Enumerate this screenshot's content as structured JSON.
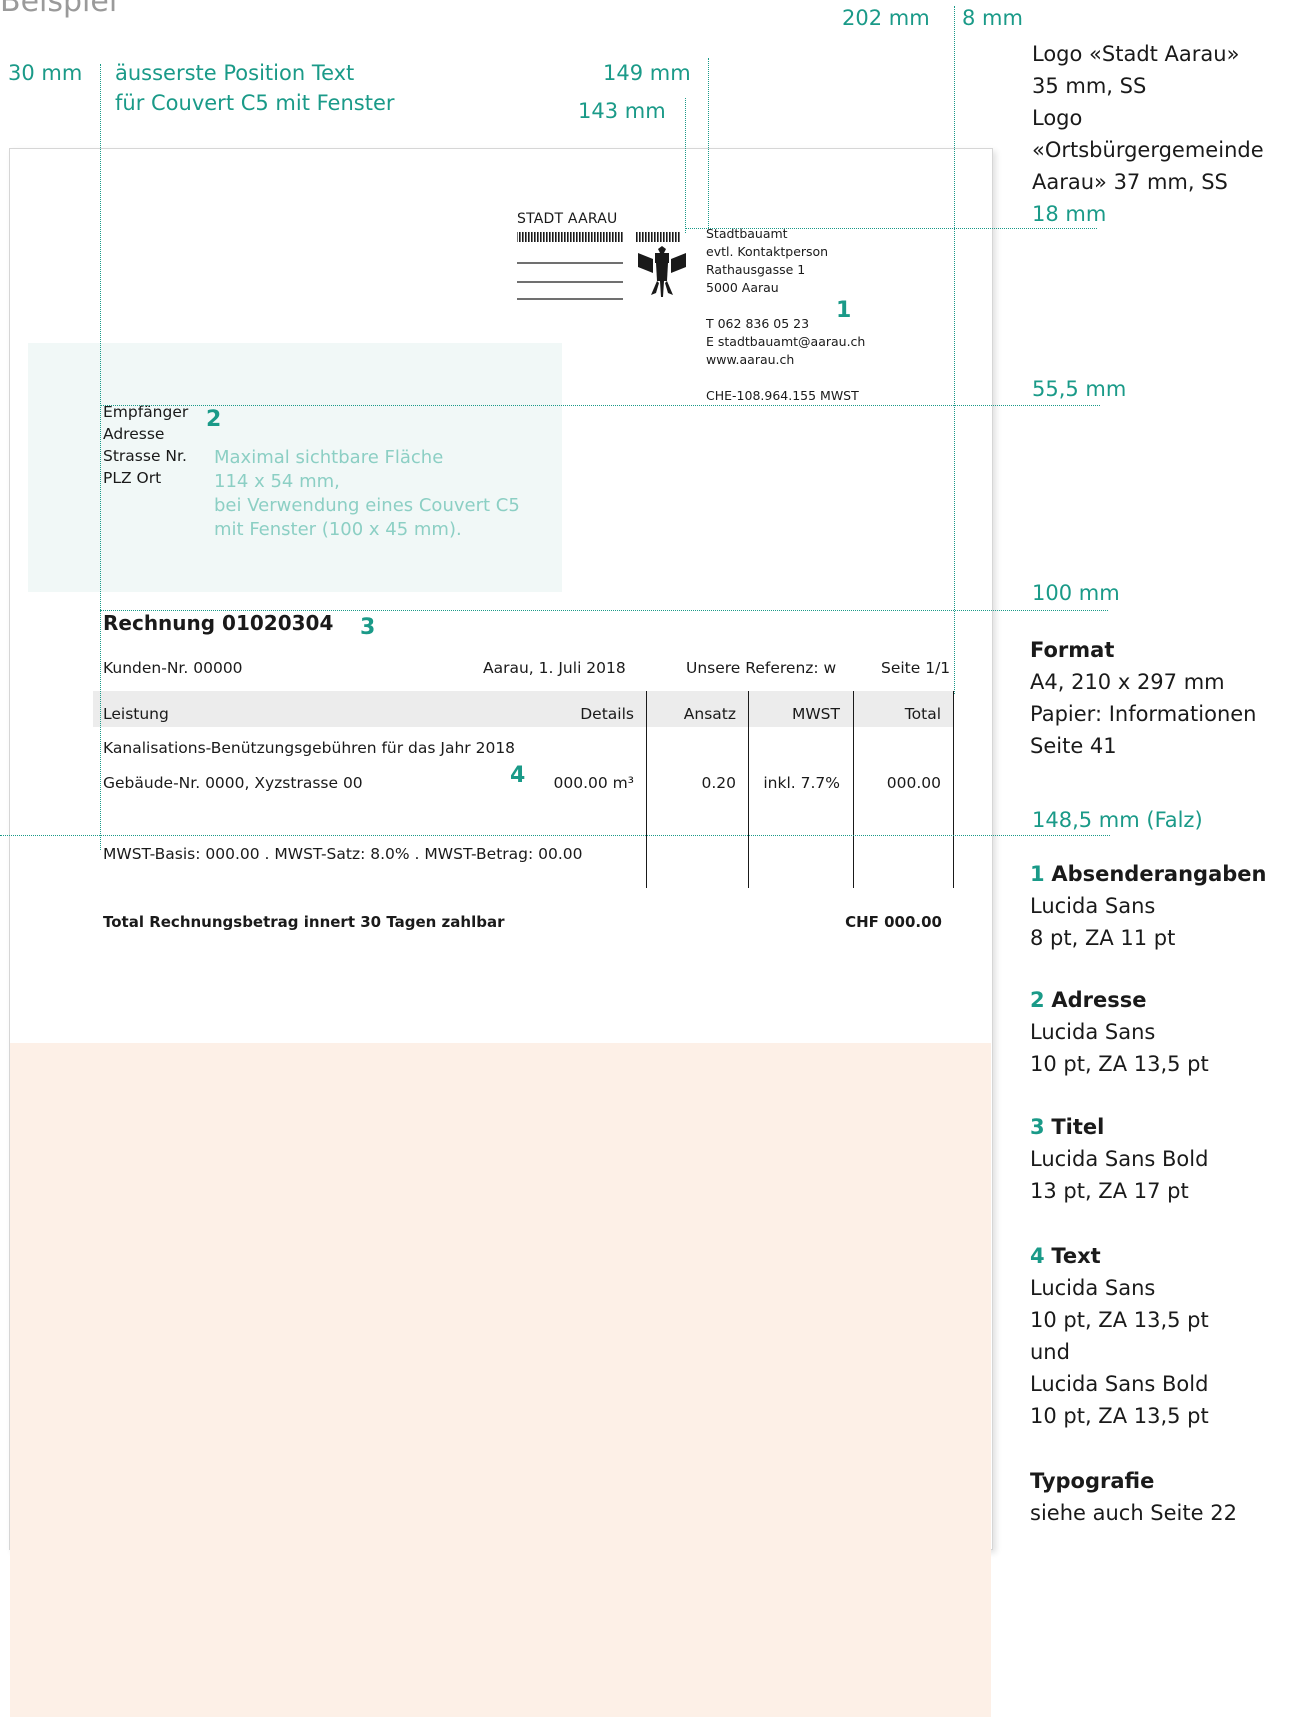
{
  "heading": "Beispiel",
  "measures": {
    "m202": "202 mm",
    "m8": "8 mm",
    "m30": "30 mm",
    "m149": "149 mm",
    "m143": "143 mm",
    "m18": "18 mm",
    "m55": "55,5 mm",
    "m100": "100 mm",
    "m148": "148,5 mm (Falz)"
  },
  "note_position": [
    "äusserste Position Text",
    "für Couvert C5 mit Fenster"
  ],
  "logo_note": [
    "Logo «Stadt Aarau»",
    "35 mm, SS",
    "Logo",
    "«Ortsbürgergemeinde",
    "Aarau» 37 mm, SS"
  ],
  "format": {
    "title": "Format",
    "lines": [
      "A4, 210 x 297 mm",
      "Papier: Informationen",
      "Seite 41"
    ]
  },
  "specs": [
    {
      "num": "1",
      "title": "Absenderangaben",
      "lines": [
        "Lucida Sans",
        "8 pt, ZA 11 pt"
      ]
    },
    {
      "num": "2",
      "title": "Adresse",
      "lines": [
        "Lucida Sans",
        "10 pt, ZA 13,5 pt"
      ]
    },
    {
      "num": "3",
      "title": "Titel",
      "lines": [
        "Lucida Sans Bold",
        "13 pt, ZA 17 pt"
      ]
    },
    {
      "num": "4",
      "title": "Text",
      "lines": [
        "Lucida Sans",
        "10 pt, ZA 13,5 pt",
        "und",
        "Lucida Sans Bold",
        "10 pt, ZA 13,5 pt"
      ]
    }
  ],
  "typografie": {
    "title": "Typografie",
    "line": "siehe auch Seite 22"
  },
  "logo_text": "STADT AARAU",
  "sender": {
    "lines": [
      "Stadtbauamt",
      "evtl. Kontaktperson",
      "Rathausgasse 1",
      "5000 Aarau"
    ],
    "phone": "T  062 836 05 23",
    "email": "E  stadtbauamt@aarau.ch",
    "web": "www.aarau.ch",
    "vat": "CHE-108.964.155 MWST"
  },
  "recipient": [
    "Empfänger",
    "Adresse",
    "Strasse Nr.",
    "PLZ Ort"
  ],
  "window_note": [
    "Maximal sichtbare Fläche",
    "114 x 54 mm,",
    "bei Verwendung eines Couvert C5",
    "mit Fenster (100 x 45 mm)."
  ],
  "markers": {
    "one": "1",
    "two": "2",
    "three": "3",
    "four": "4"
  },
  "invoice": {
    "title": "Rechnung 01020304",
    "customer": "Kunden-Nr.  00000",
    "date": "Aarau, 1. Juli 2018",
    "reference": "Unsere Referenz: w",
    "page": "Seite 1/1",
    "columns": [
      "Leistung",
      "Details",
      "Ansatz",
      "MWST",
      "Total"
    ],
    "line1": "Kanalisations-Benützungsgebühren für das Jahr 2018",
    "line2": "Gebäude-Nr.  0000, Xyzstrasse 00",
    "details": "000.00 m³",
    "ansatz": "0.20",
    "mwst": "inkl. 7.7%",
    "total": "000.00",
    "vat_line": "MWST-Basis: 000.00  .  MWST-Satz: 8.0%  .  MWST-Betrag: 00.00",
    "sum_label": "Total Rechnungsbetrag innert 30 Tagen zahlbar",
    "sum_value": "CHF  000.00"
  },
  "colors": {
    "accent": "#1a9a88",
    "window": "#f1f8f7",
    "peach": "#fdf0e7"
  }
}
